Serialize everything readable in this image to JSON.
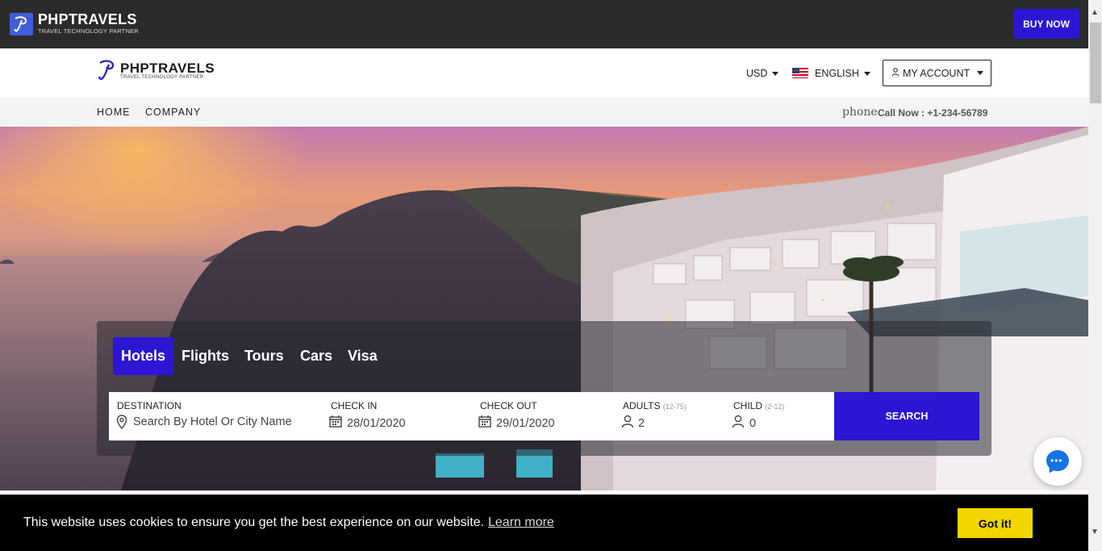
{
  "topbar": {
    "brand": "PHPTRAVELS",
    "tagline": "TRAVEL TECHNOLOGY PARTNER",
    "buy_now": "BUY NOW",
    "accent": "#2c16d3"
  },
  "header": {
    "brand": "PHPTRAVELS",
    "tagline": "TRAVEL TECHNOLOGY PARTNER",
    "currency": "USD",
    "language": "ENGLISH",
    "account": "MY ACCOUNT"
  },
  "nav": {
    "items": [
      "HOME",
      "COMPANY"
    ],
    "phone_word": "phone",
    "phone_text": "Call Now : +1-234-56789"
  },
  "search": {
    "tabs": [
      "Hotels",
      "Flights",
      "Tours",
      "Cars",
      "Visa"
    ],
    "active_tab": "Hotels",
    "destination_label": "DESTINATION",
    "destination_placeholder": "Search By Hotel Or City Name",
    "checkin_label": "CHECK IN",
    "checkin_value": "28/01/2020",
    "checkout_label": "CHECK OUT",
    "checkout_value": "29/01/2020",
    "adults_label": "ADULTS",
    "adults_range": "(12-75)",
    "adults_value": "2",
    "child_label": "CHILD",
    "child_range": "(2-12)",
    "child_value": "0",
    "search_button": "SEARCH"
  },
  "cookie": {
    "message": "This website uses cookies to ensure you get the best experience on our website.",
    "learn_more": "Learn more",
    "accept": "Got it!",
    "accept_color": "#f1d600"
  },
  "icons": {
    "location": "map-pin-icon",
    "calendar": "calendar-icon",
    "user": "user-icon",
    "chat": "chat-icon"
  }
}
